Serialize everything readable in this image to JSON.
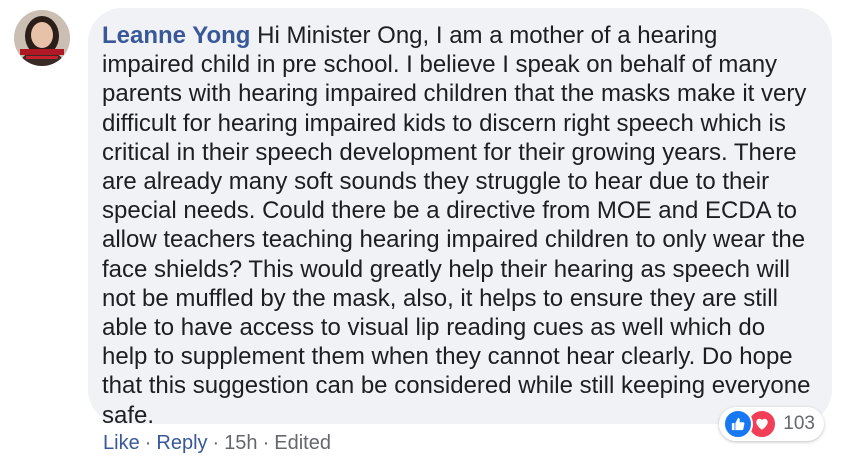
{
  "comment": {
    "author": "Leanne Yong",
    "body": "Hi Minister Ong, I am a mother of a hearing impaired child in pre school. I believe I speak on behalf of many parents with hearing impaired children that the masks make it very difficult for hearing impaired kids to discern right speech which is critical in their speech development for their growing years. There are already many soft sounds they struggle to hear due to their special needs. Could there be a directive from MOE and ECDA to allow teachers teaching hearing impaired children to only wear the face shields? This would greatly help their hearing as speech will not be muffled by the mask, also, it helps to ensure they are still able to have access to visual lip reading cues as well which do help to supplement them when they cannot hear clearly. Do hope that this suggestion can be considered while still keeping everyone safe."
  },
  "reactions": {
    "icons": [
      "like-icon",
      "love-icon"
    ],
    "count": "103",
    "colors": {
      "like": "#1877f2",
      "love": "#f33e58"
    }
  },
  "actions": {
    "like": "Like",
    "reply": "Reply",
    "time": "15h",
    "edited": "Edited",
    "separator": "·"
  },
  "colors": {
    "bubble": "#f0f2f5",
    "author": "#385898",
    "text": "#1c1e21",
    "meta": "#65676b"
  }
}
